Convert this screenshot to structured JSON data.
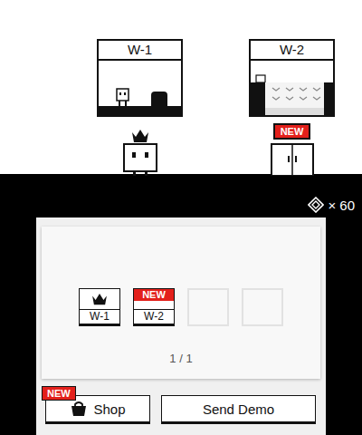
{
  "top_screen": {
    "worlds": [
      {
        "label": "W-1",
        "crowned": true,
        "badge": null,
        "player_here": true
      },
      {
        "label": "W-2",
        "crowned": false,
        "badge": "NEW",
        "player_here": false
      }
    ]
  },
  "currency": {
    "count": "× 60"
  },
  "world_select": {
    "slots": [
      {
        "label": "W-1",
        "empty": false,
        "crowned": true,
        "badge": null
      },
      {
        "label": "W-2",
        "empty": false,
        "crowned": false,
        "badge": "NEW"
      },
      {
        "label": null,
        "empty": true,
        "crowned": false,
        "badge": null
      },
      {
        "label": null,
        "empty": true,
        "crowned": false,
        "badge": null
      }
    ],
    "page": "1 / 1"
  },
  "buttons": [
    {
      "label": "Shop",
      "kind": "shop",
      "badge": "NEW"
    },
    {
      "label": "Send Demo",
      "kind": "plain",
      "badge": null
    }
  ]
}
